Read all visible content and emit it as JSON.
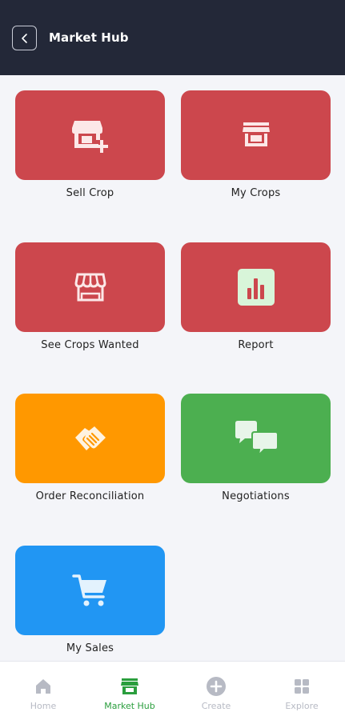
{
  "header": {
    "title": "Market Hub"
  },
  "colors": {
    "header_bg": "#232838",
    "red": "#cc474d",
    "orange": "#ff9800",
    "green": "#4caf50",
    "blue": "#2196f3",
    "nav_active": "#2a9e3d",
    "nav_inactive": "#b7bac4"
  },
  "tiles": [
    {
      "label": "Sell Crop",
      "icon": "store-add-icon",
      "color": "#cc474d"
    },
    {
      "label": "My Crops",
      "icon": "store-icon",
      "color": "#cc474d"
    },
    {
      "label": "See Crops Wanted",
      "icon": "storefront-awning-icon",
      "color": "#cc474d"
    },
    {
      "label": "Report",
      "icon": "bar-chart-icon",
      "color": "#cc474d"
    },
    {
      "label": "Order Reconciliation",
      "icon": "handshake-icon",
      "color": "#ff9800"
    },
    {
      "label": "Negotiations",
      "icon": "chat-bubbles-icon",
      "color": "#4caf50"
    },
    {
      "label": "My Sales",
      "icon": "shopping-cart-icon",
      "color": "#2196f3"
    }
  ],
  "bottom_nav": {
    "items": [
      {
        "label": "Home",
        "icon": "home-icon",
        "active": false
      },
      {
        "label": "Market Hub",
        "icon": "market-icon",
        "active": true
      },
      {
        "label": "Create",
        "icon": "plus-circle-icon",
        "active": false
      },
      {
        "label": "Explore",
        "icon": "grid-icon",
        "active": false
      }
    ]
  }
}
